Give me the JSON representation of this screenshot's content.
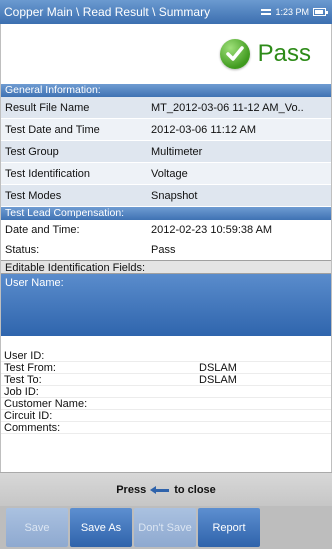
{
  "titlebar": {
    "title": "Copper Main \\ Read Result \\ Summary",
    "time": "1:23 PM"
  },
  "result": {
    "text": "Pass"
  },
  "general": {
    "header": "General Information:",
    "rows": [
      {
        "k": "Result File Name",
        "v": "MT_2012-03-06 11-12 AM_Vo.."
      },
      {
        "k": "Test Date and Time",
        "v": "2012-03-06 11:12 AM"
      },
      {
        "k": "Test Group",
        "v": "Multimeter"
      },
      {
        "k": "Test Identification",
        "v": "Voltage"
      },
      {
        "k": "Test Modes",
        "v": "Snapshot"
      }
    ]
  },
  "lead": {
    "header": "Test Lead Compensation:",
    "rows": [
      {
        "k": "Date and Time:",
        "v": "2012-02-23 10:59:38 AM"
      },
      {
        "k": "Status:",
        "v": "Pass"
      }
    ]
  },
  "editable": {
    "header": "Editable Identification Fields:",
    "user_name_label": "User Name:",
    "rows": [
      {
        "k": "User ID:",
        "v": ""
      },
      {
        "k": "Test From:",
        "v": "DSLAM"
      },
      {
        "k": "Test To:",
        "v": "DSLAM"
      },
      {
        "k": "Job ID:",
        "v": ""
      },
      {
        "k": "Customer Name:",
        "v": ""
      },
      {
        "k": "Circuit ID:",
        "v": ""
      },
      {
        "k": "Comments:",
        "v": ""
      }
    ]
  },
  "hint": {
    "before": "Press",
    "after": "to close"
  },
  "buttons": {
    "save": "Save",
    "save_as": "Save As",
    "dont_save": "Don't Save",
    "report": "Report"
  }
}
